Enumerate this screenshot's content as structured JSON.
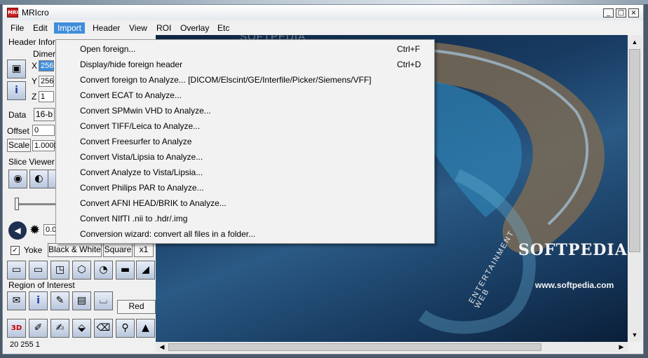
{
  "window": {
    "title": "MRIcro",
    "icon_label": "MRI"
  },
  "menubar": {
    "items": [
      "File",
      "Edit",
      "Import",
      "Header",
      "View",
      "ROI",
      "Overlay",
      "Etc"
    ],
    "active": "Import"
  },
  "import_menu": [
    {
      "label": "Open foreign...",
      "shortcut": "Ctrl+F"
    },
    {
      "label": "Display/hide foreign header",
      "shortcut": "Ctrl+D"
    },
    {
      "label": "Convert foreign to Analyze... [DICOM/Elscint/GE/Interfile/Picker/Siemens/VFF]",
      "shortcut": ""
    },
    {
      "label": "Convert ECAT to Analyze...",
      "shortcut": ""
    },
    {
      "label": "Convert SPMwin VHD to Analyze...",
      "shortcut": ""
    },
    {
      "label": "Convert TIFF/Leica to Analyze...",
      "shortcut": ""
    },
    {
      "label": "Convert Freesurfer to Analyze",
      "shortcut": ""
    },
    {
      "label": "Convert Vista/Lipsia to Analyze...",
      "shortcut": ""
    },
    {
      "label": "Convert Analyze to Vista/Lipsia...",
      "shortcut": ""
    },
    {
      "label": "Convert Philips PAR to Analyze...",
      "shortcut": ""
    },
    {
      "label": "Convert AFNI HEAD/BRIK to Analyze...",
      "shortcut": ""
    },
    {
      "label": "Convert NIfTI .nii to .hdr/.img",
      "shortcut": ""
    },
    {
      "label": "Conversion wizard: convert all files in a folder...",
      "shortcut": ""
    }
  ],
  "left_panel": {
    "header_info_label": "Header Infor",
    "dimensions_label": "Dimer",
    "x_label": "X",
    "x_value": "256",
    "y_label": "Y",
    "y_value": "256",
    "z_label": "Z",
    "z_value": "1",
    "data_label": "Data",
    "data_value": "16-b",
    "offset_label": "Offset",
    "offset_value": "0",
    "scale_button": "Scale",
    "scale_value": "1.0000",
    "slice_viewer_label": "Slice Viewer",
    "brightness_value": "0.0",
    "yoke_label": "Yoke",
    "yoke_checked": "✓",
    "colormap_button": "Black & White",
    "square_button": "Square",
    "zoom_button": "x1",
    "roi_label": "Region of Interest",
    "roi_color_button": "Red",
    "status_text": "20 255 1"
  },
  "viewer": {
    "watermark": "SOFTPEDIA",
    "brand": "SOFTPEDIA",
    "brand_mark": "®",
    "url": "www.softpedia.com",
    "web_text": "WEB",
    "ent_text": "ENTERTAINMENT"
  },
  "colors": {
    "menu_highlight": "#3f8ddb",
    "app_icon": "#c92020"
  },
  "icons": {
    "window_controls": [
      "minimize-icon",
      "maximize-icon",
      "close-icon"
    ],
    "scroll": [
      "scroll-up-icon",
      "scroll-down-icon",
      "scroll-left-icon",
      "scroll-right-icon"
    ]
  }
}
